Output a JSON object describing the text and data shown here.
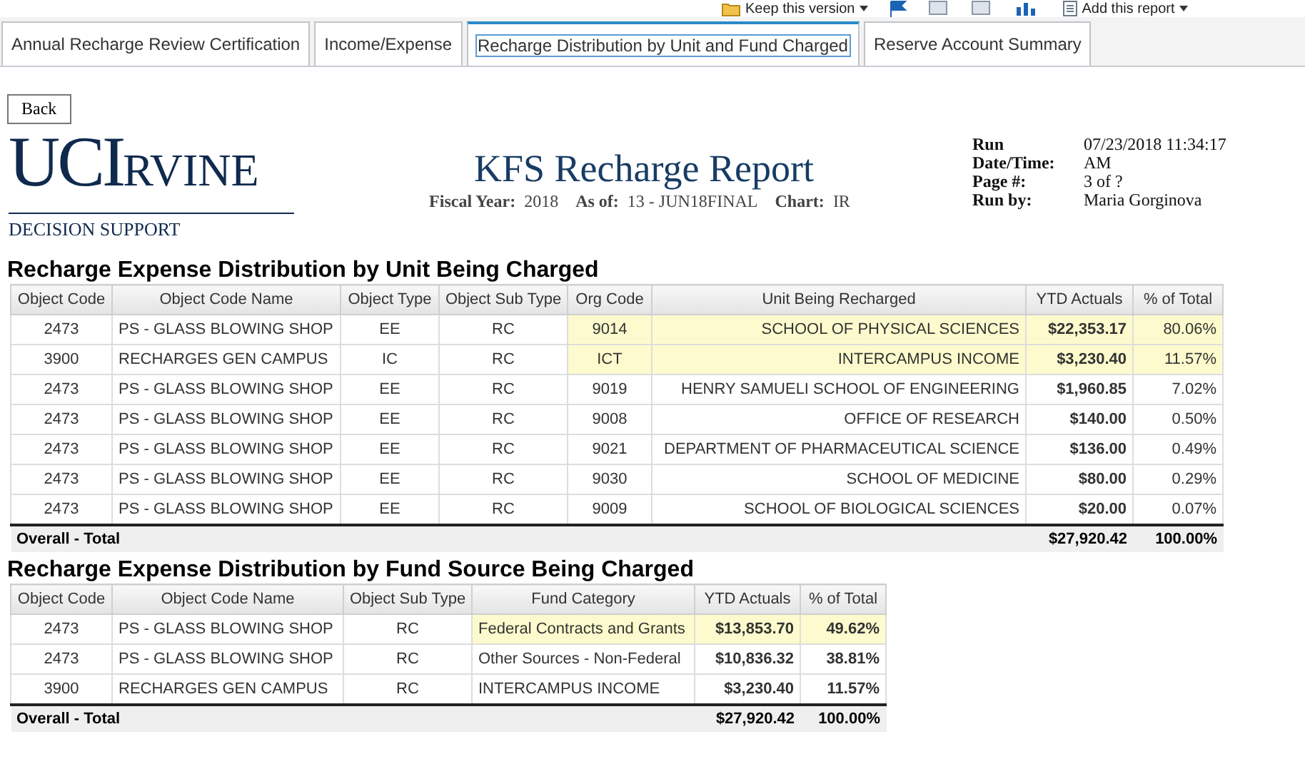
{
  "toolbar": {
    "keep_version": "Keep this version",
    "add_report": "Add this report"
  },
  "tabs": [
    {
      "label": "Annual Recharge Review Certification",
      "selected": false
    },
    {
      "label": "Income/Expense",
      "selected": false
    },
    {
      "label": "Recharge Distribution by Unit and Fund Charged",
      "selected": true
    },
    {
      "label": "Reserve Account Summary",
      "selected": false
    }
  ],
  "back_button": "Back",
  "logo": {
    "main": "UCI",
    "rest": "RVINE",
    "sub": "DECISION SUPPORT"
  },
  "report": {
    "title": "KFS Recharge Report",
    "params": [
      {
        "label": "Fiscal Year:",
        "value": "2018"
      },
      {
        "label": "As of:",
        "value": "13 - JUN18FINAL"
      },
      {
        "label": "Chart:",
        "value": "IR"
      }
    ]
  },
  "meta": [
    {
      "label": "Run Date/Time:",
      "value": "07/23/2018 11:34:17 AM"
    },
    {
      "label": "Page #:",
      "value": "3 of ?"
    },
    {
      "label": "Run by:",
      "value": "Maria Gorginova"
    }
  ],
  "tables": [
    {
      "title": "Recharge Expense Distribution by Unit Being Charged",
      "columns": [
        "Object Code",
        "Object Code Name",
        "Object Type",
        "Object Sub Type",
        "Org Code",
        "Unit Being Recharged",
        "YTD Actuals",
        "% of Total"
      ],
      "rows": [
        {
          "highlighted": true,
          "cells": [
            "2473",
            "PS - GLASS BLOWING SHOP",
            "EE",
            "RC",
            "9014",
            "SCHOOL OF PHYSICAL SCIENCES",
            "$22,353.17",
            "80.06%"
          ]
        },
        {
          "highlighted": true,
          "cells": [
            "3900",
            "RECHARGES GEN CAMPUS",
            "IC",
            "RC",
            "ICT",
            "INTERCAMPUS INCOME",
            "$3,230.40",
            "11.57%"
          ]
        },
        {
          "highlighted": false,
          "cells": [
            "2473",
            "PS - GLASS BLOWING SHOP",
            "EE",
            "RC",
            "9019",
            "HENRY SAMUELI SCHOOL OF ENGINEERING",
            "$1,960.85",
            "7.02%"
          ]
        },
        {
          "highlighted": false,
          "cells": [
            "2473",
            "PS - GLASS BLOWING SHOP",
            "EE",
            "RC",
            "9008",
            "OFFICE OF RESEARCH",
            "$140.00",
            "0.50%"
          ]
        },
        {
          "highlighted": false,
          "cells": [
            "2473",
            "PS - GLASS BLOWING SHOP",
            "EE",
            "RC",
            "9021",
            "DEPARTMENT OF PHARMACEUTICAL SCIENCE",
            "$136.00",
            "0.49%"
          ]
        },
        {
          "highlighted": false,
          "cells": [
            "2473",
            "PS - GLASS BLOWING SHOP",
            "EE",
            "RC",
            "9030",
            "SCHOOL OF MEDICINE",
            "$80.00",
            "0.29%"
          ]
        },
        {
          "highlighted": false,
          "cells": [
            "2473",
            "PS - GLASS BLOWING SHOP",
            "EE",
            "RC",
            "9009",
            "SCHOOL OF BIOLOGICAL SCIENCES",
            "$20.00",
            "0.07%"
          ]
        }
      ],
      "total": {
        "label": "Overall - Total",
        "ytd": "$27,920.42",
        "percent": "100.00%"
      }
    },
    {
      "title": "Recharge Expense Distribution by Fund Source Being Charged",
      "columns": [
        "Object Code",
        "Object Code Name",
        "Object Sub Type",
        "Fund Category",
        "YTD Actuals",
        "% of Total"
      ],
      "rows": [
        {
          "highlighted": true,
          "cells": [
            "2473",
            "PS - GLASS BLOWING SHOP",
            "RC",
            "Federal Contracts and Grants",
            "$13,853.70",
            "49.62%"
          ]
        },
        {
          "highlighted": false,
          "cells": [
            "2473",
            "PS - GLASS BLOWING SHOP",
            "RC",
            "Other Sources - Non-Federal",
            "$10,836.32",
            "38.81%"
          ]
        },
        {
          "highlighted": false,
          "cells": [
            "3900",
            "RECHARGES GEN CAMPUS",
            "RC",
            "INTERCAMPUS INCOME",
            "$3,230.40",
            "11.57%"
          ]
        }
      ],
      "total": {
        "label": "Overall - Total",
        "ytd": "$27,920.42",
        "percent": "100.00%"
      }
    }
  ]
}
